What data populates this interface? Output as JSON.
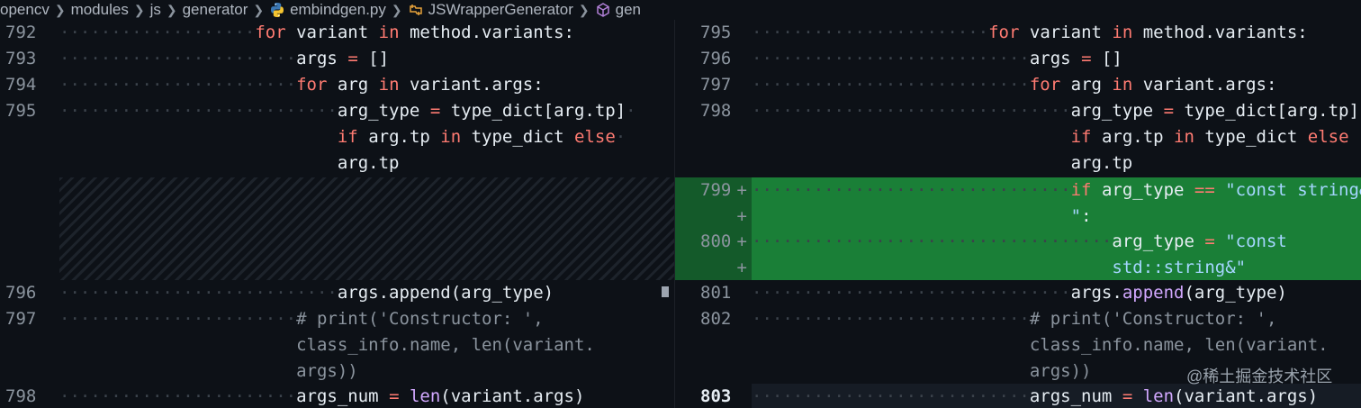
{
  "breadcrumb": {
    "items": [
      {
        "label": "opencv",
        "icon": ""
      },
      {
        "label": "modules",
        "icon": ""
      },
      {
        "label": "js",
        "icon": ""
      },
      {
        "label": "generator",
        "icon": ""
      },
      {
        "label": "embindgen.py",
        "icon": "python-file-icon"
      },
      {
        "label": "JSWrapperGenerator",
        "icon": "class-symbol-icon"
      },
      {
        "label": "gen",
        "icon": "method-symbol-icon"
      }
    ]
  },
  "left": {
    "line_numbers": [
      "792",
      "793",
      "794",
      "795",
      "796",
      "797",
      "798"
    ],
    "code": {
      "l792_kw": "for",
      "l792_rest": " variant ",
      "l792_in": "in",
      "l792_tail": " method.variants:",
      "l793_id": "args ",
      "l793_op": "=",
      "l793_tail": " []",
      "l794_kw": "for",
      "l794_id": " arg ",
      "l794_in": "in",
      "l794_tail": " variant.args:",
      "l795a_id": "arg_type ",
      "l795a_op": "=",
      "l795a_tail": " type_dict[arg.tp]",
      "l795b_if": "if",
      "l795b_mid": " arg.tp ",
      "l795b_in": "in",
      "l795b_mid2": " type_dict ",
      "l795b_else": "else",
      "l795c": "arg.tp",
      "l796": "args.append(arg_type)",
      "l797a": "# print('Constructor: ',",
      "l797b": "class_info.name, len(variant.",
      "l797c": "args))",
      "l798_id": "args_num ",
      "l798_op": "=",
      "l798_fn": " len",
      "l798_tail": "(variant.args)"
    }
  },
  "right": {
    "line_numbers": [
      "795",
      "796",
      "797",
      "798",
      "799",
      "800",
      "801",
      "802",
      "803"
    ],
    "plus": "+",
    "code": {
      "l795_kw": "for",
      "l795_rest": " variant ",
      "l795_in": "in",
      "l795_tail": " method.variants:",
      "l796_id": "args ",
      "l796_op": "=",
      "l796_tail": " []",
      "l797_kw": "for",
      "l797_id": " arg ",
      "l797_in": "in",
      "l797_tail": " variant.args:",
      "l798a_id": "arg_type ",
      "l798a_op": "=",
      "l798a_tail": " type_dict[arg.tp]",
      "l798b_if": "if",
      "l798b_mid": " arg.tp ",
      "l798b_in": "in",
      "l798b_mid2": " type_dict ",
      "l798b_else": "else",
      "l798c": "arg.tp",
      "l799a_if": "if",
      "l799a_id": " arg_type ",
      "l799a_op": "==",
      "l799a_str": " \"const string&",
      "l799b_str": "\"",
      "l799b_tail": ":",
      "l800a_id": "arg_type ",
      "l800a_op": "=",
      "l800a_str": " \"const",
      "l800b_str": "std::string&\"",
      "l801_id": "args.",
      "l801_fn": "append",
      "l801_tail": "(arg_type)",
      "l802a": "# print('Constructor: ',",
      "l802b": "class_info.name, len(variant.",
      "l802c": "args))",
      "l803_id": "args_num ",
      "l803_op": "=",
      "l803_fn": " len",
      "l803_tail": "(variant.args)"
    }
  },
  "watermark": "@稀土掘金技术社区",
  "colors": {
    "background": "#0d1117",
    "keyword": "#ff7b72",
    "string": "#a5d6ff",
    "function": "#d2a8ff",
    "added_line": "#1a7f37",
    "added_gutter": "#145a2a"
  }
}
